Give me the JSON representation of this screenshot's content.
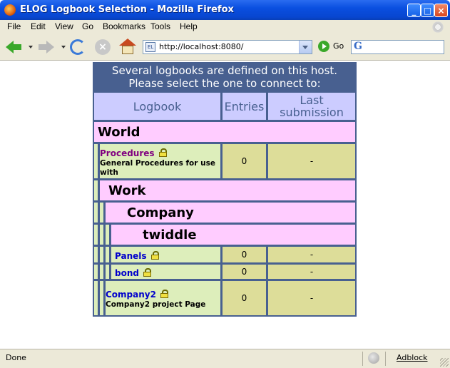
{
  "window": {
    "title": "ELOG Logbook Selection - Mozilla Firefox",
    "controls": [
      "_",
      "□",
      "×"
    ]
  },
  "menu": [
    "File",
    "Edit",
    "View",
    "Go",
    "Bookmarks",
    "Tools",
    "Help"
  ],
  "toolbar": {
    "url": "http://localhost:8080/",
    "go_label": "Go",
    "search_engine_glyph": "G",
    "favicon_text": "EL"
  },
  "page": {
    "header": "Several logbooks are defined on this host. Please select the one to connect to:",
    "columns": {
      "logbook": "Logbook",
      "entries": "Entries",
      "last_submission": "Last submission"
    },
    "groups": {
      "world": "World",
      "work": "Work",
      "company": "Company",
      "twiddle": "twiddle"
    },
    "logbooks": {
      "procedures": {
        "name": "Procedures",
        "description": "General Procedures for use with",
        "entries": "0",
        "last": "-",
        "color": "#800080"
      },
      "panels": {
        "name": "Panels",
        "description": "",
        "entries": "0",
        "last": "-",
        "color": "#0000cc"
      },
      "bond": {
        "name": "bond",
        "description": "",
        "entries": "0",
        "last": "-",
        "color": "#0000cc"
      },
      "company2": {
        "name": "Company2",
        "description": "Company2 project Page",
        "entries": "0",
        "last": "-",
        "color": "#0000cc"
      }
    }
  },
  "status": {
    "text": "Done",
    "adblock": "Adblock"
  },
  "colors": {
    "header_bg": "#486090",
    "column_header_bg": "#ccccff",
    "group_bg": "#ffccff",
    "logbook_cell_bg": "#ddeebb",
    "value_cell_bg": "#dddd99"
  }
}
